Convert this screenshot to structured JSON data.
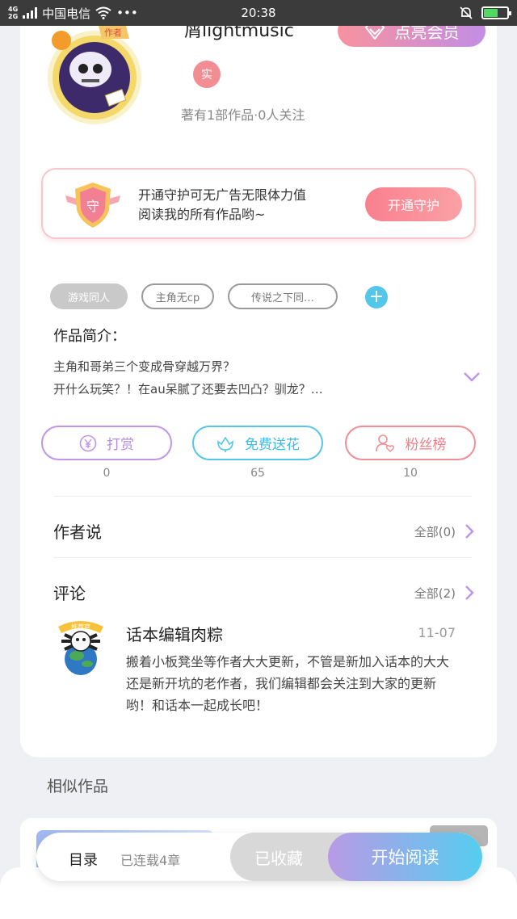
{
  "status_bar": {
    "network": "4G",
    "network2": "2G",
    "carrier": "中国电信",
    "dots": "•••",
    "time": "20:38"
  },
  "author": {
    "name": "屑lightmusic",
    "avatar_badge": "作者",
    "real_badge": "实",
    "stats": "著有1部作品·0人关注"
  },
  "vip_button": {
    "label": "点亮会员"
  },
  "guard": {
    "badge": "守",
    "line1": "开通守护可无广告无限体力值",
    "line2": "阅读我的所有作品哟~",
    "button": "开通守护"
  },
  "tags": [
    "游戏同人",
    "主角无cp",
    "传说之下同…"
  ],
  "tag_add": "+",
  "intro": {
    "title": "作品简介：",
    "line1": "主角和哥弟三个变成骨穿越万界？",
    "line2": "开什么玩笑？！在au呆腻了还要去凹凸？驯龙？…"
  },
  "actions": [
    {
      "label": "打赏",
      "count": "0"
    },
    {
      "label": "免费送花",
      "count": "65"
    },
    {
      "label": "粉丝榜",
      "count": "10"
    }
  ],
  "author_says": {
    "title": "作者说",
    "more": "全部(0)"
  },
  "comments": {
    "title": "评论",
    "more": "全部(2)",
    "items": [
      {
        "user": "话本编辑肉粽",
        "date": "11-07",
        "badge": "推荐官",
        "text": "搬着小板凳坐等作者大大更新，不管是新加入话本的大大还是新开坑的老作者，我们编辑都会关注到大家的更新哟！和话本一起成长吧！"
      }
    ]
  },
  "similar": {
    "title": "相似作品"
  },
  "bottom_bar": {
    "toc_label": "目录",
    "chapter_count": "已连载4章",
    "collect_label": "已收藏",
    "read_label": "开始阅读"
  },
  "colors": {
    "accent_pink": "#f28d93",
    "accent_purple": "#c195e7",
    "accent_cyan": "#54c6ea",
    "vip_gradient_start": "#f8929e",
    "vip_gradient_end": "#c28ee6"
  }
}
